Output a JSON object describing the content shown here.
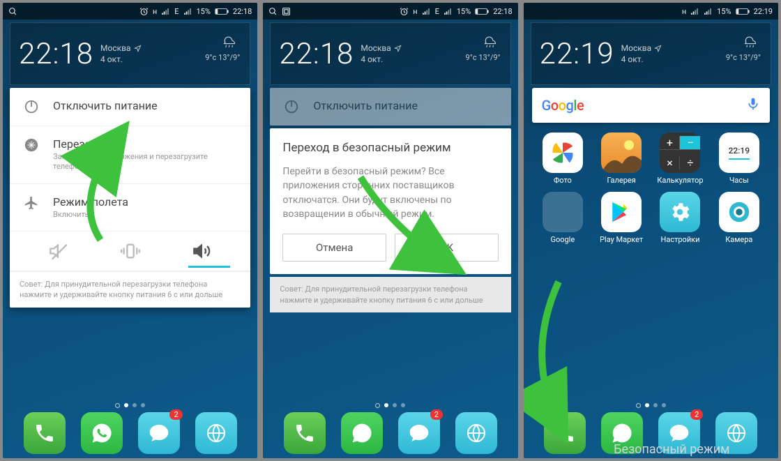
{
  "status": {
    "net": "н",
    "signal_e": "E",
    "battery_pct": "15%",
    "time1": "22:18",
    "time2": "22:18",
    "time3": "22:19"
  },
  "widget": {
    "time1": "22:18",
    "time2": "22:18",
    "time3": "22:19",
    "city": "Москва",
    "date": "4 окт.",
    "temp_hi_lo": "13°/9°",
    "temp_now": "9°c"
  },
  "power": {
    "off_title": "Отключить питание",
    "restart_title": "Перезапуск",
    "restart_sub": "Закройте все приложения и перезагрузите телефон",
    "airplane_title": "Режим полета",
    "airplane_sub": "Включить",
    "hint": "Совет: Для принудительной перезагрузки телефона нажмите и удерживайте кнопку питания 6 с или дольше"
  },
  "dialog": {
    "title": "Переход в безопасный режим",
    "body": "Перейти в безопасный режим? Все приложения сторонних поставщиков отключатся. Они будут включены по возвращении в обычный режим.",
    "cancel": "Отмена",
    "ok": "OK"
  },
  "search_brand": "Google",
  "apps": {
    "photos": "Фото",
    "gallery": "Галерея",
    "calc": "Калькулятор",
    "clock": "Часы",
    "clock_time": "22:19",
    "google": "Google",
    "play": "Play Маркет",
    "settings": "Настройки",
    "camera": "Камера"
  },
  "badge_count": "2",
  "safe_mode_label": "Безопасный режим"
}
